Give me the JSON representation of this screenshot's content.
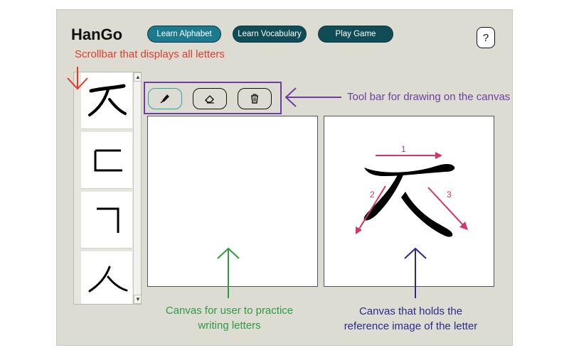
{
  "app": {
    "title": "HanGo"
  },
  "nav": {
    "learn_alphabet": "Learn Alphabet",
    "learn_vocabulary": "Learn Vocabulary",
    "play_game": "Play Game",
    "help": "?"
  },
  "letters": [
    "ㅈ",
    "ㄷ",
    "ㄱ",
    "ㅅ"
  ],
  "toolbar": {
    "tools": [
      "pen-icon",
      "eraser-icon",
      "trash-icon"
    ],
    "active": "pen-icon"
  },
  "reference": {
    "letter": "ㅈ",
    "stroke_numbers": [
      "1",
      "2",
      "3"
    ]
  },
  "annotations": {
    "scrollbar": "Scrollbar that displays all letters",
    "toolbar": "Tool bar for drawing on the canvas",
    "practice_line1": "Canvas for user to practice",
    "practice_line2": "writing letters",
    "reference_line1": "Canvas that holds the",
    "reference_line2": "reference image of the letter"
  },
  "colors": {
    "app_background": "#dcdcd3",
    "primary_button": "#1b7a8e",
    "dark_button": "#0f4c55",
    "annotation_red": "#e23b2a",
    "annotation_purple": "#6b3fa0",
    "annotation_green": "#2f9a44",
    "annotation_blue": "#2b2a8c",
    "stroke_arrows": "#d6336c"
  }
}
